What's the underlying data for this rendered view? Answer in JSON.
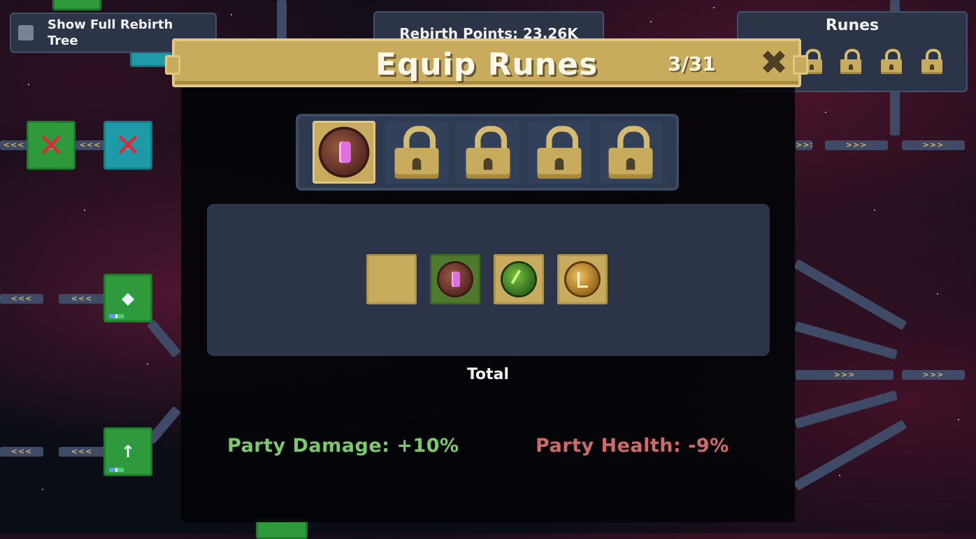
{
  "hud": {
    "show_full_tree_label": "Show Full Rebirth Tree",
    "rebirth_points": "Rebirth Points: 23.26K",
    "runes_panel_title": "Runes"
  },
  "modal": {
    "title": "Equip Runes",
    "count": "3/31",
    "close_glyph": "✖",
    "slots": [
      {
        "state": "equipped",
        "rune": "red-crystal-rune"
      },
      {
        "state": "locked"
      },
      {
        "state": "locked"
      },
      {
        "state": "locked"
      },
      {
        "state": "locked"
      }
    ],
    "inventory": [
      {
        "rune": "empty"
      },
      {
        "rune": "red-crystal-rune",
        "selected": true
      },
      {
        "rune": "green-leaf-rune"
      },
      {
        "rune": "gold-rune"
      }
    ],
    "total_label": "Total",
    "stats": {
      "party_damage": "Party Damage: +10%",
      "party_health": "Party Health: -9%"
    }
  },
  "links": {
    "left": "<<<",
    "right": ">>>"
  },
  "colors": {
    "gold": "#c9ab5e",
    "panel": "#2c3447",
    "positive": "#7cc86a",
    "negative": "#d06a68",
    "node_green": "#2e9a3b",
    "node_teal": "#1e9aa8"
  }
}
